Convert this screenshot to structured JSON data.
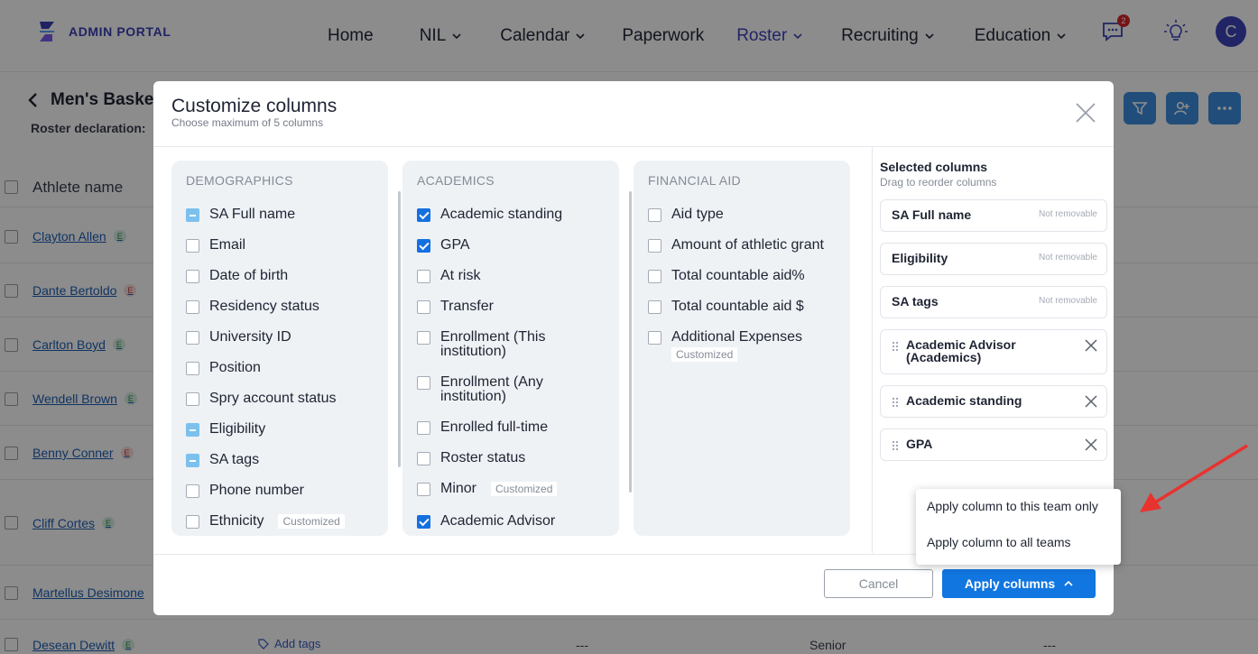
{
  "brand": {
    "name": "ADMIN PORTAL"
  },
  "nav": {
    "items": [
      {
        "label": "Home",
        "dropdown": false
      },
      {
        "label": "NIL",
        "dropdown": true
      },
      {
        "label": "Calendar",
        "dropdown": true
      },
      {
        "label": "Paperwork",
        "dropdown": false
      },
      {
        "label": "Roster",
        "dropdown": true,
        "active": true
      },
      {
        "label": "Recruiting",
        "dropdown": true
      },
      {
        "label": "Education",
        "dropdown": true
      }
    ],
    "messages_badge": "2",
    "avatar_initial": "C"
  },
  "page": {
    "title": "Men's Basket",
    "roster_declaration_label": "Roster declaration:"
  },
  "table": {
    "header_name": "Athlete name",
    "rows": [
      {
        "name": "Clayton Allen",
        "eligibility": "E",
        "status": "green"
      },
      {
        "name": "Dante Bertoldo",
        "eligibility": "E",
        "status": "red"
      },
      {
        "name": "Carlton Boyd",
        "eligibility": "E",
        "status": "green"
      },
      {
        "name": "Wendell Brown",
        "eligibility": "E",
        "status": "green"
      },
      {
        "name": "Benny Conner",
        "eligibility": "E",
        "status": "red"
      },
      {
        "name": "Cliff Cortes",
        "eligibility": "E",
        "status": "green"
      },
      {
        "name": "Martellus Desimone",
        "eligibility": "",
        "status": ""
      },
      {
        "name": "Desean Dewitt",
        "eligibility": "E",
        "status": "green",
        "add_tags": "Add tags",
        "col_a": "---",
        "col_b": "Senior",
        "col_c": "---"
      }
    ]
  },
  "modal": {
    "title": "Customize columns",
    "subtitle": "Choose maximum of 5 columns",
    "groups": [
      {
        "title": "DEMOGRAPHICS",
        "options": [
          {
            "label": "SA Full name",
            "state": "locked"
          },
          {
            "label": "Email",
            "state": "unchecked"
          },
          {
            "label": "Date of birth",
            "state": "unchecked"
          },
          {
            "label": "Residency status",
            "state": "unchecked"
          },
          {
            "label": "University ID",
            "state": "unchecked"
          },
          {
            "label": "Position",
            "state": "unchecked"
          },
          {
            "label": "Spry account status",
            "state": "unchecked"
          },
          {
            "label": "Eligibility",
            "state": "locked"
          },
          {
            "label": "SA tags",
            "state": "locked"
          },
          {
            "label": "Phone number",
            "state": "unchecked"
          },
          {
            "label": "Ethnicity",
            "state": "unchecked",
            "tag": "Customized"
          }
        ]
      },
      {
        "title": "ACADEMICS",
        "options": [
          {
            "label": "Academic standing",
            "state": "checked"
          },
          {
            "label": "GPA",
            "state": "checked"
          },
          {
            "label": "At risk",
            "state": "unchecked"
          },
          {
            "label": "Transfer",
            "state": "unchecked"
          },
          {
            "label": "Enrollment (This institution)",
            "state": "unchecked"
          },
          {
            "label": "Enrollment (Any institution)",
            "state": "unchecked"
          },
          {
            "label": "Enrolled full-time",
            "state": "unchecked"
          },
          {
            "label": "Roster status",
            "state": "unchecked"
          },
          {
            "label": "Minor",
            "state": "unchecked",
            "tag": "Customized"
          },
          {
            "label": "Academic Advisor",
            "state": "checked"
          }
        ]
      },
      {
        "title": "FINANCIAL AID",
        "options": [
          {
            "label": "Aid type",
            "state": "unchecked"
          },
          {
            "label": "Amount of athletic grant",
            "state": "unchecked"
          },
          {
            "label": "Total countable aid%",
            "state": "unchecked"
          },
          {
            "label": "Total countable aid $",
            "state": "unchecked"
          },
          {
            "label": "Additional Expenses",
            "state": "unchecked",
            "tag": "Customized"
          }
        ]
      }
    ],
    "selected": {
      "title": "Selected columns",
      "subtitle": "Drag to reorder columns",
      "not_removable_label": "Not removable",
      "items": [
        {
          "label": "SA Full name",
          "removable": false
        },
        {
          "label": "Eligibility",
          "removable": false
        },
        {
          "label": "SA tags",
          "removable": false
        },
        {
          "label": "Academic Advisor (Academics)",
          "removable": true
        },
        {
          "label": "Academic standing",
          "removable": true
        },
        {
          "label": "GPA",
          "removable": true
        }
      ]
    },
    "cancel_label": "Cancel",
    "apply_label": "Apply columns",
    "apply_menu": [
      "Apply column to this team only",
      "Apply column to all teams"
    ]
  },
  "colors": {
    "brand": "#3b3fb5",
    "primary_button": "#1176e0",
    "annotation_arrow": "#e8322e"
  }
}
